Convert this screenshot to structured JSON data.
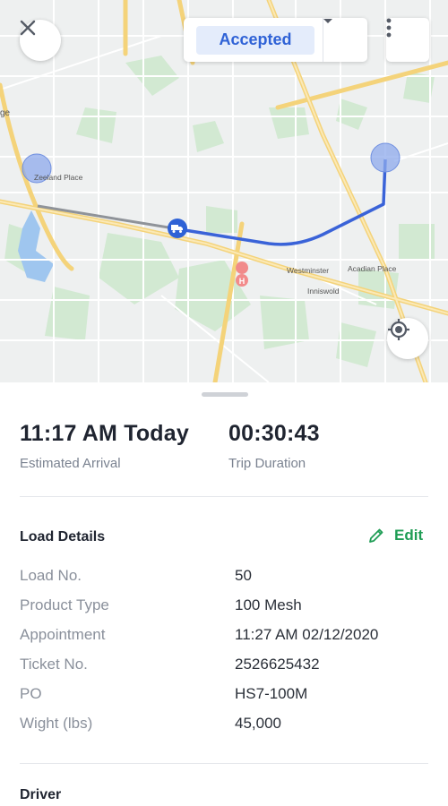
{
  "map": {
    "labels": {
      "westminster": "Westminster",
      "acadian": "Acadian Place",
      "inniswold": "Inniswold",
      "zeeland": "Zeeland Place",
      "edge": "ge"
    }
  },
  "header": {
    "status": "Accepted"
  },
  "trip": {
    "arrival_value": "11:17 AM Today",
    "arrival_label": "Estimated Arrival",
    "duration_value": "00:30:43",
    "duration_label": "Trip Duration"
  },
  "load_details": {
    "title": "Load Details",
    "edit_label": "Edit",
    "rows": [
      {
        "label": "Load No.",
        "value": "50"
      },
      {
        "label": "Product Type",
        "value": "100 Mesh"
      },
      {
        "label": "Appointment",
        "value": "11:27 AM 02/12/2020"
      },
      {
        "label": "Ticket No.",
        "value": "2526625432"
      },
      {
        "label": "PO",
        "value": "HS7-100M"
      },
      {
        "label": "Wight (lbs)",
        "value": "45,000"
      }
    ]
  },
  "driver": {
    "title": "Driver"
  },
  "colors": {
    "accent_blue": "#2f62d6",
    "edit_green": "#1f9d55",
    "route_blue": "#3a63d8"
  },
  "icons": {
    "close": "close-icon",
    "caret": "caret-down-icon",
    "more": "more-vertical-icon",
    "locate": "crosshair-icon",
    "truck": "truck-icon",
    "edit": "pencil-icon"
  }
}
